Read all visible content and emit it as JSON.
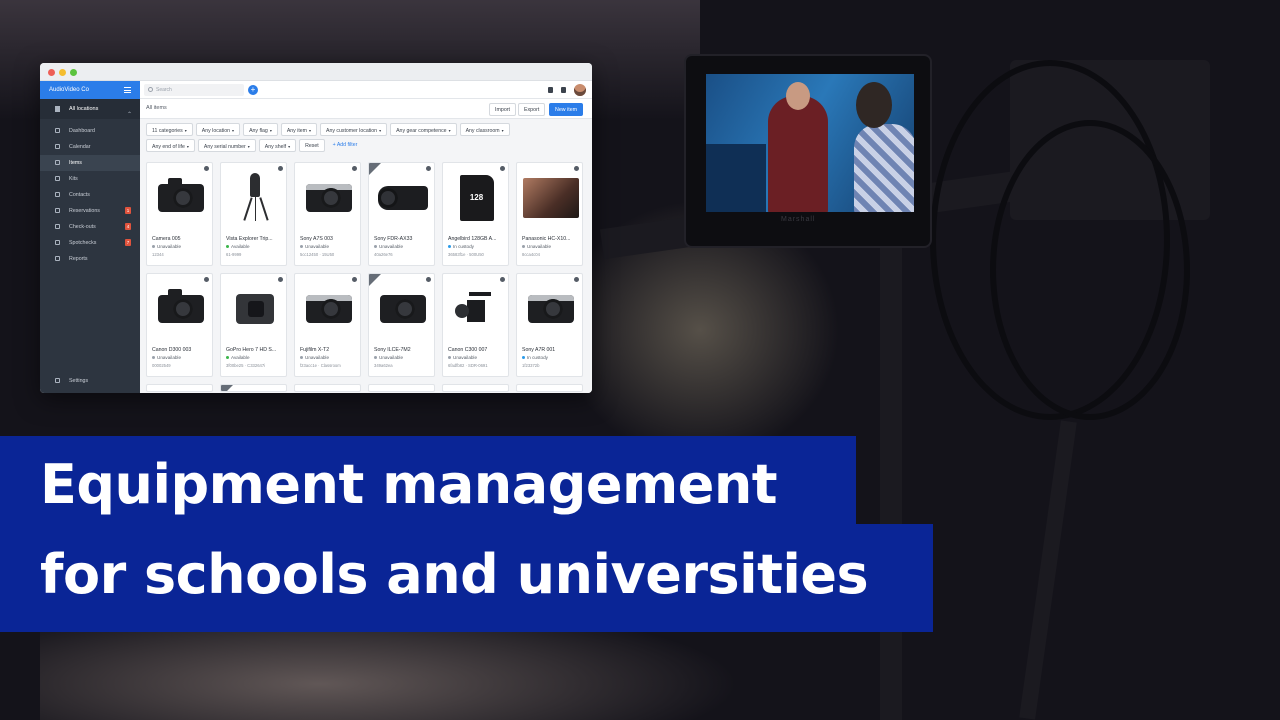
{
  "app": {
    "brand": "AudioVideo Co",
    "location": "All locations",
    "nav": [
      {
        "label": "Dashboard"
      },
      {
        "label": "Calendar"
      },
      {
        "label": "Items"
      },
      {
        "label": "Kits"
      },
      {
        "label": "Contacts"
      },
      {
        "label": "Reservations",
        "badge": "1"
      },
      {
        "label": "Check-outs",
        "badge": "4"
      },
      {
        "label": "Spotchecks",
        "badge": "7"
      },
      {
        "label": "Reports"
      }
    ],
    "settings_label": "Settings",
    "search_placeholder": "Search",
    "page_title": "All items",
    "buttons": {
      "import": "Import",
      "export": "Export",
      "new_item": "New item"
    },
    "filters": [
      "11 categories",
      "Any location",
      "Any flag",
      "Any item",
      "Any customer location",
      "Any gear competence",
      "Any classroom",
      "Any end of life",
      "Any serial number",
      "Any shelf"
    ],
    "reset_label": "Reset",
    "add_filter_label": "+ Add filter",
    "items": [
      {
        "name": "Camera 005",
        "status": "Unavailable",
        "status_color": "#9aa1ab",
        "meta": "12344"
      },
      {
        "name": "Vista Explorer Trip...",
        "status": "Available",
        "status_color": "#3bb54a",
        "meta": "61-9999"
      },
      {
        "name": "Sony A7S 003",
        "status": "Unavailable",
        "status_color": "#9aa1ab",
        "meta": "5cc12450 · 15U50"
      },
      {
        "name": "Sony FDR-AX33",
        "status": "Unavailable",
        "status_color": "#9aa1ab",
        "meta": "40a26e76"
      },
      {
        "name": "Angelbird 128GB A...",
        "status": "In custody",
        "status_color": "#2b9be9",
        "meta": "36583f1e · 500U50"
      },
      {
        "name": "Panasonic HC-X10...",
        "status": "Unavailable",
        "status_color": "#9aa1ab",
        "meta": "8cca4c04"
      },
      {
        "name": "Canon D300 003",
        "status": "Unavailable",
        "status_color": "#9aa1ab",
        "meta": "00002549"
      },
      {
        "name": "GoPro Hero 7 HD S...",
        "status": "Available",
        "status_color": "#3bb54a",
        "meta": "3f00be25 · C332647i"
      },
      {
        "name": "Fujifilm X-T2",
        "status": "Unavailable",
        "status_color": "#9aa1ab",
        "meta": "f23acc1e · Classroom"
      },
      {
        "name": "Sony ILCE-7M2",
        "status": "Unavailable",
        "status_color": "#9aa1ab",
        "meta": "349a62ea"
      },
      {
        "name": "Canon C300 007",
        "status": "Unavailable",
        "status_color": "#9aa1ab",
        "meta": "6fadfb82 · SDR-0691"
      },
      {
        "name": "Sony A7R 001",
        "status": "In custody",
        "status_color": "#2b9be9",
        "meta": "1f23372b"
      }
    ]
  },
  "monitor_brand": "Marshall",
  "headline": {
    "line1": "Equipment management",
    "line2": "for schools and universities"
  },
  "colors": {
    "accent": "#2b7de9",
    "banner": "#0a2596",
    "sidebar": "#2d3540"
  }
}
